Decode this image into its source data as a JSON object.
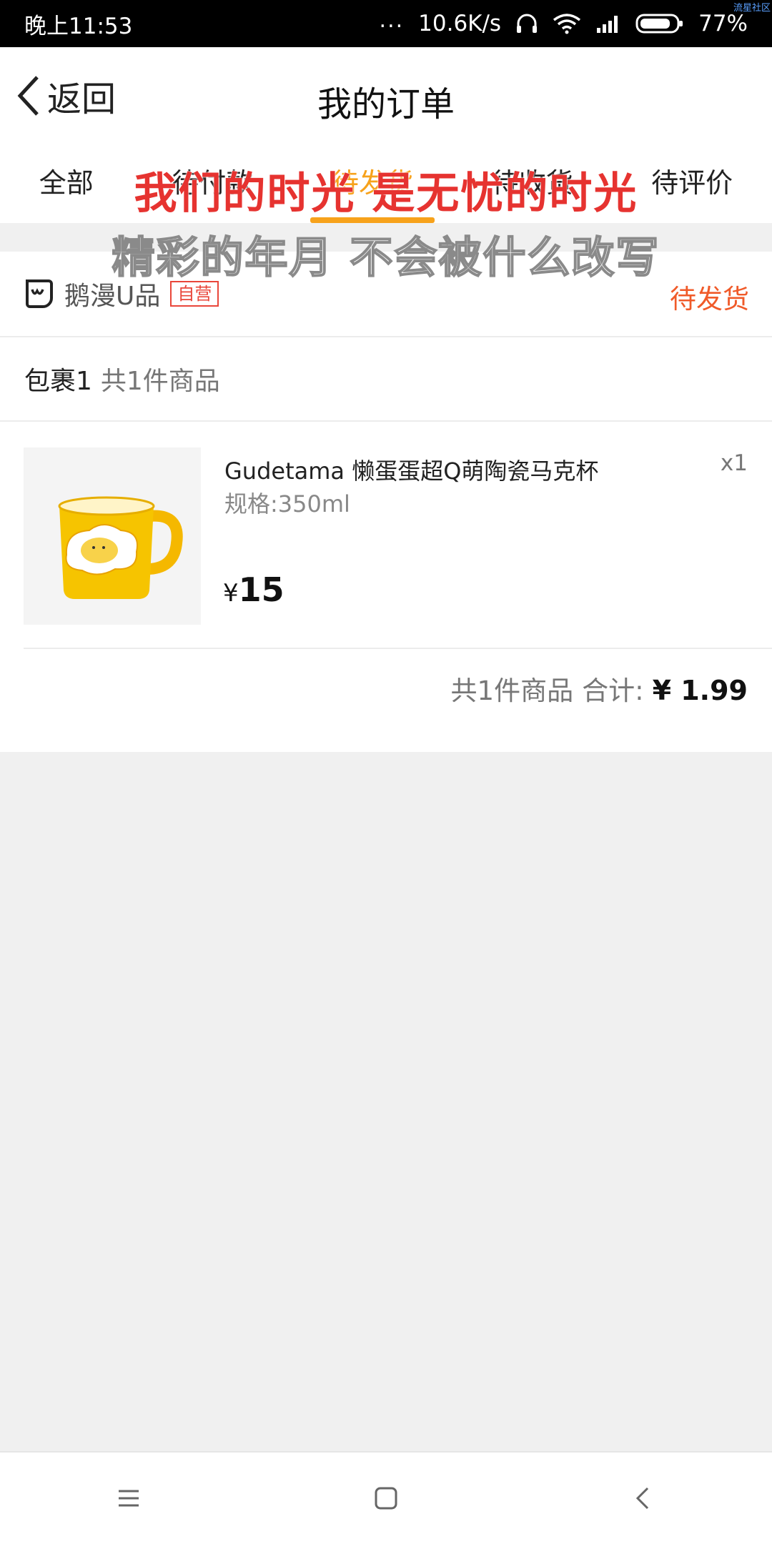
{
  "status_bar": {
    "time": "晚上11:53",
    "dots": "...",
    "network_speed": "10.6K/s",
    "battery": "77%",
    "corner_tag": "流星社区",
    "icons": [
      "headset-icon",
      "wifi-icon",
      "signal-icon",
      "battery-icon"
    ]
  },
  "header": {
    "back_label": "返回",
    "title": "我的订单"
  },
  "tabs": [
    {
      "label": "全部",
      "active": false
    },
    {
      "label": "待付款",
      "active": false
    },
    {
      "label": "待发货",
      "active": true
    },
    {
      "label": "待收货",
      "active": false
    },
    {
      "label": "待评价",
      "active": false
    }
  ],
  "order": {
    "shop_name": "鹅漫U品",
    "self_badge": "自营",
    "status": "待发货",
    "package_name": "包裹1",
    "package_count": "共1件商品",
    "item": {
      "title": "Gudetama 懒蛋蛋超Q萌陶瓷马克杯",
      "spec": "规格:350ml",
      "qty": "x1",
      "currency": "¥",
      "price": "15"
    },
    "summary": {
      "count": "共1件商品",
      "total_label": "合计:",
      "total_amount": "¥ 1.99"
    }
  },
  "subtitles": {
    "line1": "我们的时光 是无忧的时光",
    "line2": "精彩的年月 不会被什么改写"
  },
  "nav": [
    "menu-icon",
    "home-icon",
    "back-icon"
  ],
  "colors": {
    "accent": "#f7a21b",
    "status": "#f05a29",
    "badge": "#e9463a",
    "subtitle_red": "#e63330"
  }
}
